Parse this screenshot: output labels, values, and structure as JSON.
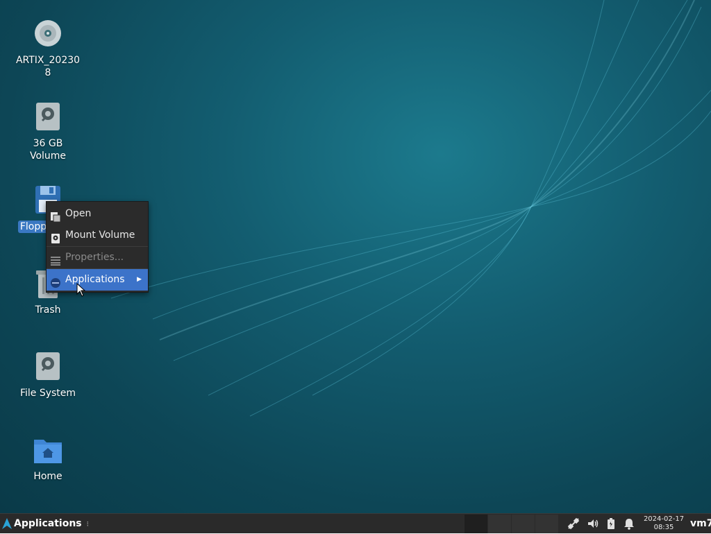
{
  "desktop": {
    "icons": [
      {
        "name": "artix-disc",
        "label": "ARTIX_20230\n8",
        "label_line1": "ARTIX_20230",
        "label_line2": "8",
        "icon": "optical-disc-icon"
      },
      {
        "name": "36gb-volume",
        "label_line1": "36 GB",
        "label_line2": "Volume",
        "icon": "harddisk-icon"
      },
      {
        "name": "floppy",
        "label_line1": "Flopp",
        "icon": "floppy-icon",
        "selected": true
      },
      {
        "name": "trash",
        "label_line1": "Trash",
        "icon": "trash-icon"
      },
      {
        "name": "file-system",
        "label_line1": "File System",
        "icon": "harddisk-icon"
      },
      {
        "name": "home",
        "label_line1": "Home",
        "icon": "home-folder-icon"
      }
    ]
  },
  "context_menu": {
    "items": [
      {
        "label": "Open",
        "icon": "open-icon",
        "enabled": true
      },
      {
        "label": "Mount Volume",
        "icon": "drive-icon",
        "enabled": true
      },
      {
        "label": "Properties...",
        "icon": "properties-icon",
        "enabled": false
      },
      {
        "label": "Applications",
        "icon": "applications-icon",
        "enabled": true,
        "active": true,
        "submenu": true
      }
    ]
  },
  "taskbar": {
    "apps_label": "Applications",
    "clock_date": "2024-02-17",
    "clock_time": "08:35",
    "user": "vm7",
    "tray": [
      "network-icon",
      "volume-icon",
      "battery-icon",
      "notification-bell-icon"
    ]
  },
  "colors": {
    "selection": "#3a78c2",
    "menu_active": "#3c73c9",
    "taskbar": "#2a2a2a"
  }
}
